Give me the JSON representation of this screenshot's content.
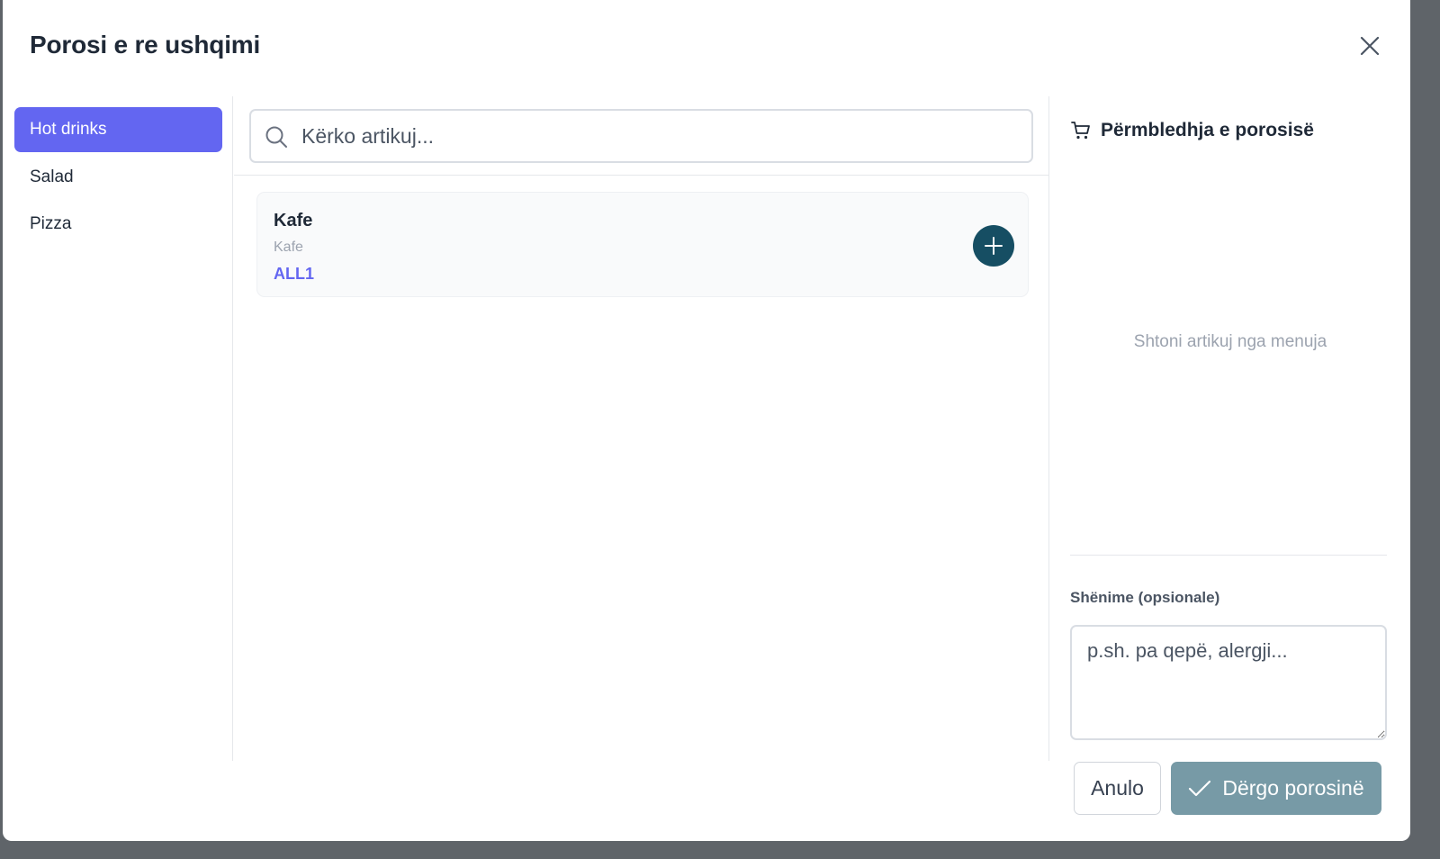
{
  "header": {
    "title": "Porosi e re ushqimi",
    "close_icon": "close-icon"
  },
  "categories": [
    {
      "label": "Hot drinks",
      "active": true
    },
    {
      "label": "Salad",
      "active": false
    },
    {
      "label": "Pizza",
      "active": false
    }
  ],
  "search": {
    "placeholder": "Kërko artikuj...",
    "value": ""
  },
  "items": [
    {
      "name": "Kafe",
      "description": "Kafe",
      "price": "ALL1"
    }
  ],
  "summary": {
    "title": "Përmbledhja e porosisë",
    "icon": "cart-icon",
    "empty_text": "Shtoni artikuj nga menuja",
    "notes_label": "Shënime (opsionale)",
    "notes_placeholder": "p.sh. pa qepë, alergji..."
  },
  "footer": {
    "cancel_label": "Anulo",
    "submit_label": "Dërgo porosinë"
  },
  "colors": {
    "accent": "#6366f1",
    "add_button": "#164e63",
    "submit_button": "#779aa6",
    "backdrop": "#5f6469"
  }
}
